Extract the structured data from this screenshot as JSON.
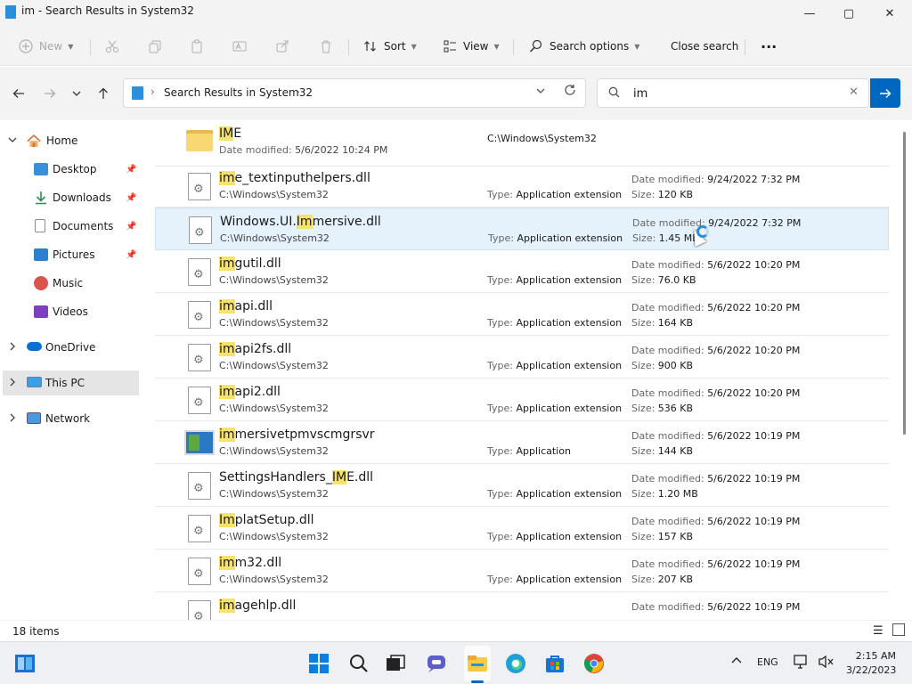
{
  "window": {
    "title": "im - Search Results in System32",
    "min": "—",
    "max": "▢",
    "close": "✕"
  },
  "commandbar": {
    "new_label": "New",
    "sort_label": "Sort",
    "view_label": "View",
    "search_options_label": "Search options",
    "close_search_label": "Close search",
    "more_label": "···"
  },
  "address": {
    "crumb": "Search Results in System32"
  },
  "search": {
    "value": "im"
  },
  "sidebar": {
    "items": [
      {
        "label": "Home"
      },
      {
        "label": "Desktop"
      },
      {
        "label": "Downloads"
      },
      {
        "label": "Documents"
      },
      {
        "label": "Pictures"
      },
      {
        "label": "Music"
      },
      {
        "label": "Videos"
      },
      {
        "label": "OneDrive"
      },
      {
        "label": "This PC"
      },
      {
        "label": "Network"
      }
    ]
  },
  "labels": {
    "date_modified": "Date modified:",
    "type": "Type:",
    "size": "Size:"
  },
  "results": [
    {
      "hl": "IM",
      "rest": "E",
      "pre": "",
      "path": "C:\\Windows\\System32",
      "date": "5/6/2022 10:24 PM",
      "kind": "folder"
    },
    {
      "hl": "im",
      "pre": "",
      "rest": "e_textinputhelpers.dll",
      "sub": "C:\\Windows\\System32",
      "type": "Application extension",
      "date": "9/24/2022 7:32 PM",
      "size": "120 KB"
    },
    {
      "pre": "Windows.UI.",
      "hl": "Im",
      "rest": "mersive.dll",
      "sub": "C:\\Windows\\System32",
      "type": "Application extension",
      "date": "9/24/2022 7:32 PM",
      "size": "1.45 MB"
    },
    {
      "pre": "",
      "hl": "im",
      "rest": "gutil.dll",
      "sub": "C:\\Windows\\System32",
      "type": "Application extension",
      "date": "5/6/2022 10:20 PM",
      "size": "76.0 KB"
    },
    {
      "pre": "",
      "hl": "im",
      "rest": "api.dll",
      "sub": "C:\\Windows\\System32",
      "type": "Application extension",
      "date": "5/6/2022 10:20 PM",
      "size": "164 KB"
    },
    {
      "pre": "",
      "hl": "im",
      "rest": "api2fs.dll",
      "sub": "C:\\Windows\\System32",
      "type": "Application extension",
      "date": "5/6/2022 10:20 PM",
      "size": "900 KB"
    },
    {
      "pre": "",
      "hl": "im",
      "rest": "api2.dll",
      "sub": "C:\\Windows\\System32",
      "type": "Application extension",
      "date": "5/6/2022 10:20 PM",
      "size": "536 KB"
    },
    {
      "pre": "",
      "hl": "im",
      "rest": "mersivetpmvscmgrsvr",
      "sub": "C:\\Windows\\System32",
      "type": "Application",
      "date": "5/6/2022 10:19 PM",
      "size": "144 KB",
      "kind": "app"
    },
    {
      "pre": "SettingsHandlers_",
      "hl": "IM",
      "rest": "E.dll",
      "sub": "C:\\Windows\\System32",
      "type": "Application extension",
      "date": "5/6/2022 10:19 PM",
      "size": "1.20 MB"
    },
    {
      "pre": "",
      "hl": "Im",
      "rest": "platSetup.dll",
      "sub": "C:\\Windows\\System32",
      "type": "Application extension",
      "date": "5/6/2022 10:19 PM",
      "size": "157 KB"
    },
    {
      "pre": "",
      "hl": "im",
      "rest": "m32.dll",
      "sub": "C:\\Windows\\System32",
      "type": "Application extension",
      "date": "5/6/2022 10:19 PM",
      "size": "207 KB"
    },
    {
      "pre": "",
      "hl": "im",
      "rest": "agehlp.dll",
      "sub": "",
      "type": "",
      "date": "5/6/2022 10:19 PM",
      "size": ""
    }
  ],
  "status": {
    "count": "18 items"
  },
  "taskbar": {
    "lang": "ENG",
    "time": "2:15 AM",
    "date": "3/22/2023"
  },
  "colors": {
    "accent": "#0067c0",
    "highlight": "#f6e36b",
    "hover_row": "#e5f1fb"
  }
}
